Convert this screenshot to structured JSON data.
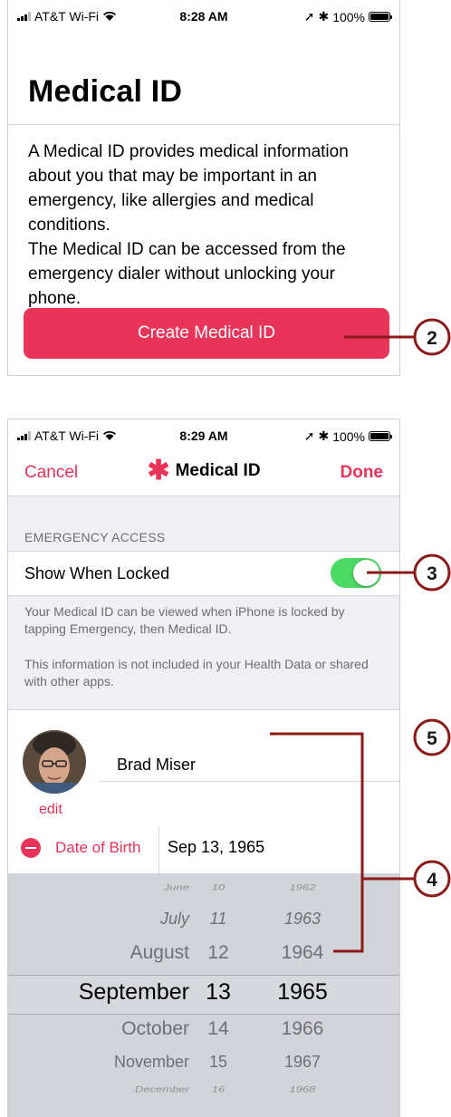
{
  "colors": {
    "accent": "#e9345a",
    "toggle_on": "#4cd964",
    "callout": "#8b1a1a"
  },
  "screen1": {
    "status": {
      "carrier": "AT&T Wi-Fi",
      "time": "8:28 AM",
      "battery": "100%"
    },
    "title": "Medical ID",
    "description": [
      "A Medical ID provides medical information about you that may be important in an emergency, like allergies and medical conditions.",
      "The Medical ID can be accessed from the emergency dialer without unlocking your phone."
    ],
    "button": "Create Medical ID"
  },
  "screen2": {
    "status": {
      "carrier": "AT&T Wi-Fi",
      "time": "8:29 AM",
      "battery": "100%"
    },
    "nav": {
      "cancel": "Cancel",
      "title": "Medical ID",
      "done": "Done"
    },
    "section_header": "EMERGENCY ACCESS",
    "toggle": {
      "label": "Show When Locked",
      "on": true
    },
    "footnotes": [
      "Your Medical ID can be viewed when iPhone is locked by tapping Emergency, then Medical ID.",
      "This information is not included in your Health Data or shared with other apps."
    ],
    "profile": {
      "name": "Brad Miser",
      "edit": "edit"
    },
    "dob": {
      "label": "Date of Birth",
      "value": "Sep 13, 1965"
    },
    "picker": {
      "months": [
        "June",
        "July",
        "August",
        "September",
        "October",
        "November",
        "December"
      ],
      "days": [
        "10",
        "11",
        "12",
        "13",
        "14",
        "15",
        "16"
      ],
      "years": [
        "1962",
        "1963",
        "1964",
        "1965",
        "1966",
        "1967",
        "1968"
      ]
    }
  },
  "callouts": [
    "2",
    "3",
    "5",
    "4"
  ]
}
